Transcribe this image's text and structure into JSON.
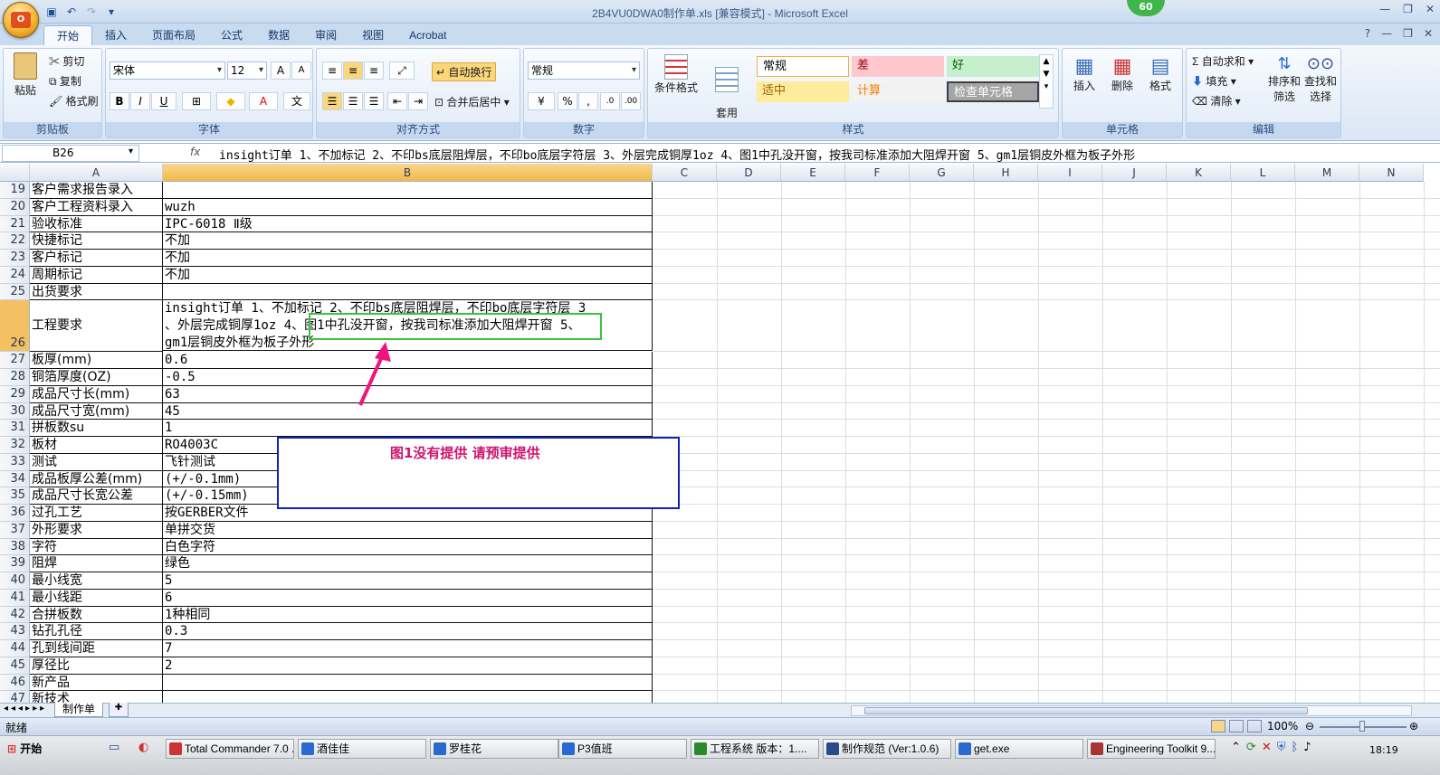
{
  "window": {
    "title": "2B4VU0DWA0制作单.xls  [兼容模式] - Microsoft Excel",
    "badge": "60",
    "office_logo": "Office"
  },
  "ribbon_tabs": [
    "开始",
    "插入",
    "页面布局",
    "公式",
    "数据",
    "审阅",
    "视图",
    "Acrobat"
  ],
  "clipboard": {
    "paste": "粘贴",
    "cut": "剪切",
    "copy": "复制",
    "format_painter": "格式刷",
    "label": "剪贴板"
  },
  "font": {
    "name": "宋体",
    "size": "12",
    "label": "字体",
    "grow": "A",
    "shrink": "A",
    "bold": "B",
    "italic": "I",
    "underline": "U"
  },
  "alignment": {
    "wrap": "自动换行",
    "merge": "合并后居中",
    "label": "对齐方式"
  },
  "number": {
    "format": "常规",
    "percent": "%",
    "comma": ",",
    "label": "数字"
  },
  "styles": {
    "conditional": "条件格式",
    "table_format": "套用\n表格格式",
    "label": "样式",
    "cells": [
      {
        "text": "常规",
        "bg": "#ffffff",
        "color": "#000000"
      },
      {
        "text": "差",
        "bg": "#ffc7ce",
        "color": "#9c0006"
      },
      {
        "text": "好",
        "bg": "#c6efce",
        "color": "#006100"
      },
      {
        "text": "适中",
        "bg": "#ffeb9c",
        "color": "#9c6500"
      },
      {
        "text": "计算",
        "bg": "#f2f2f2",
        "color": "#fa7d00"
      },
      {
        "text": "检查单元格",
        "bg": "#a5a5a5",
        "color": "#ffffff"
      }
    ]
  },
  "cells_group": {
    "insert": "插入",
    "delete": "删除",
    "format": "格式",
    "label": "单元格"
  },
  "editing": {
    "autosum": "自动求和",
    "fill": "填充",
    "clear": "清除",
    "sort": "排序和\n筛选",
    "find": "查找和\n选择",
    "label": "编辑"
  },
  "formula_bar": {
    "name_box": "B26",
    "fx": "fx",
    "content": "insight订单   1、不加标记  2、不印bs底层阻焊层，不印bo底层字符层  3、外层完成铜厚1oz  4、图1中孔没开窗，按我司标准添加大阻焊开窗  5、gm1层铜皮外框为板子外形"
  },
  "columns": [
    "A",
    "B",
    "C",
    "D",
    "E",
    "F",
    "G",
    "H",
    "I",
    "J",
    "K",
    "L",
    "M",
    "N"
  ],
  "rows": [
    {
      "num": "19",
      "a": "客户需求报告录入",
      "b": ""
    },
    {
      "num": "20",
      "a": "客户工程资料录入",
      "b": "wuzh"
    },
    {
      "num": "21",
      "a": "验收标准",
      "b": "IPC-6018 Ⅱ级"
    },
    {
      "num": "22",
      "a": "快捷标记",
      "b": "不加"
    },
    {
      "num": "23",
      "a": "客户标记",
      "b": "不加"
    },
    {
      "num": "24",
      "a": "周期标记",
      "b": "不加"
    },
    {
      "num": "25",
      "a": "出货要求",
      "b": ""
    },
    {
      "num": "26",
      "a": "工程要求",
      "b": ""
    },
    {
      "num": "27",
      "a": "板厚(mm)",
      "b": "0.6"
    },
    {
      "num": "28",
      "a": "铜箔厚度(OZ)",
      "b": "-0.5"
    },
    {
      "num": "29",
      "a": "成品尺寸长(mm)",
      "b": "63"
    },
    {
      "num": "30",
      "a": "成品尺寸宽(mm)",
      "b": "45"
    },
    {
      "num": "31",
      "a": "拼板数su",
      "b": "1"
    },
    {
      "num": "32",
      "a": "板材",
      "b": "RO4003C"
    },
    {
      "num": "33",
      "a": "测试",
      "b": "飞针测试"
    },
    {
      "num": "34",
      "a": "成品板厚公差(mm)",
      "b": "(+/-0.1mm)"
    },
    {
      "num": "35",
      "a": "成品尺寸长宽公差",
      "b": "(+/-0.15mm)"
    },
    {
      "num": "36",
      "a": "过孔工艺",
      "b": "按GERBER文件"
    },
    {
      "num": "37",
      "a": "外形要求",
      "b": "单拼交货"
    },
    {
      "num": "38",
      "a": "字符",
      "b": "白色字符"
    },
    {
      "num": "39",
      "a": "阻焊",
      "b": "绿色"
    },
    {
      "num": "40",
      "a": "最小线宽",
      "b": "5"
    },
    {
      "num": "41",
      "a": "最小线距",
      "b": "6"
    },
    {
      "num": "42",
      "a": "合拼板数",
      "b": "1种相同"
    },
    {
      "num": "43",
      "a": "钻孔孔径",
      "b": "0.3"
    },
    {
      "num": "44",
      "a": "孔到线间距",
      "b": "7"
    },
    {
      "num": "45",
      "a": "厚径比",
      "b": "2"
    },
    {
      "num": "46",
      "a": "新产品",
      "b": ""
    },
    {
      "num": "47",
      "a": "新技术",
      "b": ""
    }
  ],
  "b26_lines": [
    "insight订单   1、不加标记  2、不印bs底层阻焊层，不印bo底层字符层  3",
    "、外层完成铜厚1oz  4、图1中孔没开窗，按我司标准添加大阻焊开窗  5、",
    "gm1层铜皮外框为板子外形"
  ],
  "annotation": {
    "text": "图1没有提供    请预审提供"
  },
  "sheet_tab": "制作单",
  "status": {
    "ready": "就绪",
    "zoom": "100%"
  },
  "taskbar": {
    "start": "开始",
    "items": [
      "Total Commander 7.0 ...",
      "酒佳佳",
      "罗桂花",
      "P3值班",
      "工程系统  版本：1....",
      "制作规范 (Ver:1.0.6)",
      "get.exe",
      "Engineering Toolkit 9...."
    ],
    "clock": "18:19"
  }
}
